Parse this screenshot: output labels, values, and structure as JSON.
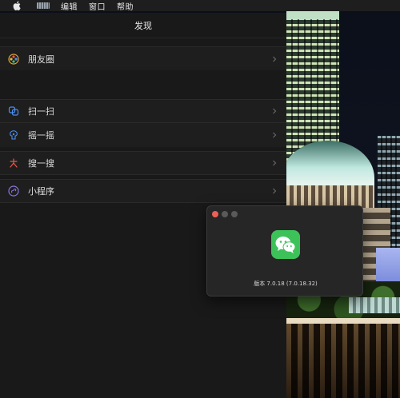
{
  "menubar": {
    "items": [
      "编辑",
      "窗口",
      "帮助"
    ]
  },
  "discover": {
    "title": "发现",
    "items": [
      {
        "label": "朋友圈",
        "icon": "moments-icon",
        "color": "#e0a23a"
      },
      {
        "label": "扫一扫",
        "icon": "scan-icon",
        "color": "#4a8ff0"
      },
      {
        "label": "摇一摇",
        "icon": "shake-icon",
        "color": "#4a8ff0"
      },
      {
        "label": "搜一搜",
        "icon": "search-icon",
        "color": "#e05a4a"
      },
      {
        "label": "小程序",
        "icon": "mini-program-icon",
        "color": "#8a74e0"
      }
    ]
  },
  "about": {
    "version": "版本 7.0.18 (7.0.18.32)"
  },
  "colors": {
    "wechat_green": "#3dc25a",
    "panel_bg": "#191919",
    "row_bg": "#1e1e1e"
  }
}
